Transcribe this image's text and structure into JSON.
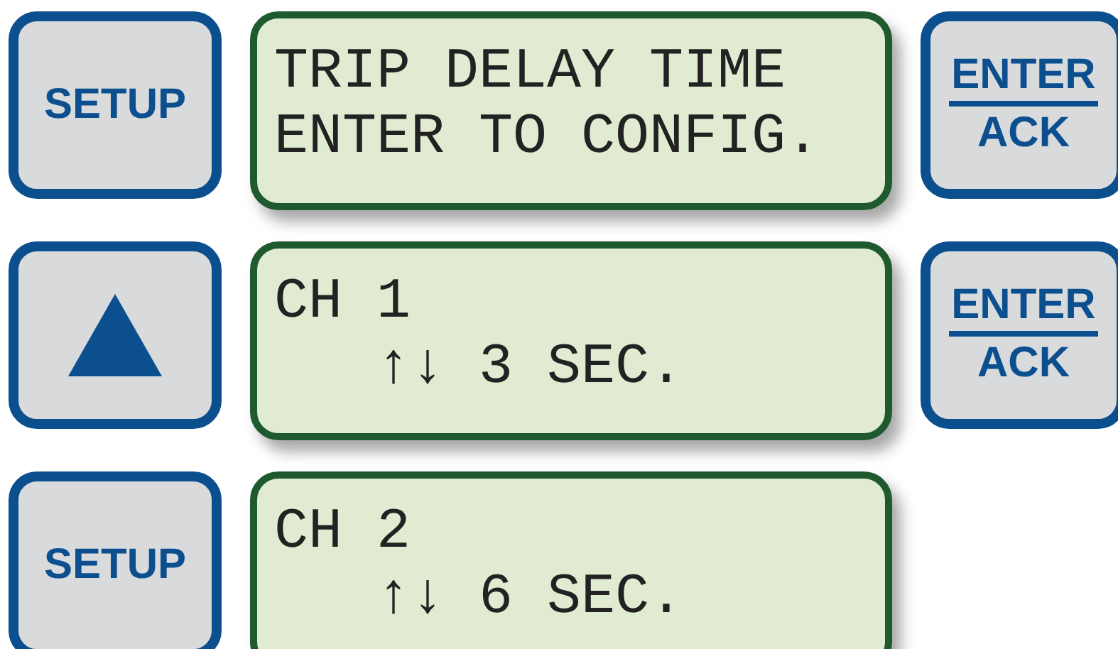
{
  "rows": [
    {
      "left_button": {
        "kind": "text",
        "label": "SETUP"
      },
      "display": {
        "lines": [
          "TRIP DELAY TIME",
          "ENTER TO CONFIG."
        ]
      },
      "right_button": {
        "kind": "enter_ack",
        "top": "ENTER",
        "bottom": "ACK"
      }
    },
    {
      "left_button": {
        "kind": "up_arrow"
      },
      "display": {
        "lines": [
          "CH 1",
          "   ↑↓ 3 SEC."
        ]
      },
      "right_button": {
        "kind": "enter_ack",
        "top": "ENTER",
        "bottom": "ACK"
      }
    },
    {
      "left_button": {
        "kind": "text",
        "label": "SETUP"
      },
      "display": {
        "lines": [
          "CH 2",
          "   ↑↓ 6 SEC."
        ]
      }
    }
  ]
}
